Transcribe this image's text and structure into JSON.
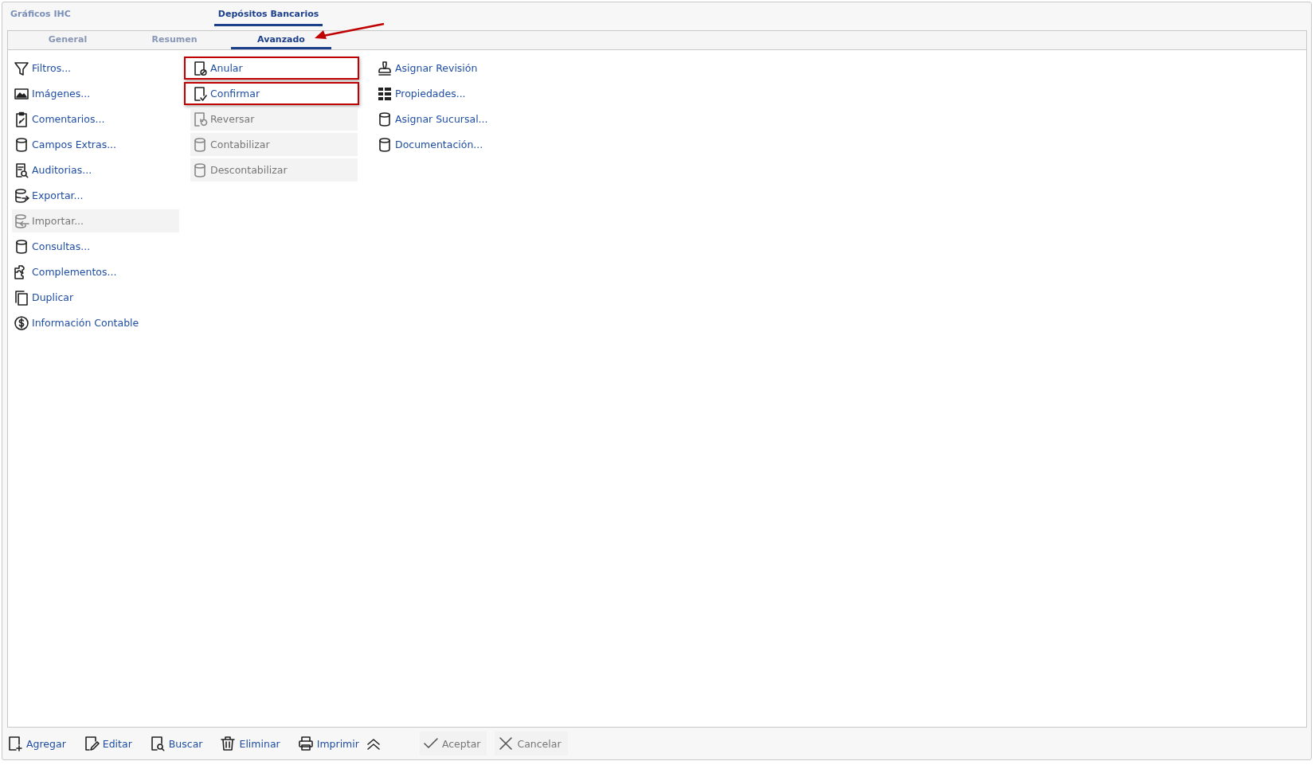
{
  "tabs": [
    {
      "label": "Gráficos IHC",
      "selected": false
    },
    {
      "label": "Depósitos Bancarios",
      "selected": true
    }
  ],
  "subtabs": [
    {
      "label": "General",
      "selected": false
    },
    {
      "label": "Resumen",
      "selected": false
    },
    {
      "label": "Avanzado",
      "selected": true
    }
  ],
  "columns": [
    [
      {
        "label": "Filtros...",
        "kind": "funnel",
        "disabled": false,
        "highlighted": false
      },
      {
        "label": "Imágenes...",
        "kind": "image",
        "disabled": false,
        "highlighted": false
      },
      {
        "label": "Comentarios...",
        "kind": "clipboard",
        "disabled": false,
        "highlighted": false
      },
      {
        "label": "Campos Extras...",
        "kind": "database",
        "disabled": false,
        "highlighted": false
      },
      {
        "label": "Auditorias...",
        "kind": "audit",
        "disabled": false,
        "highlighted": false
      },
      {
        "label": "Exportar...",
        "kind": "export",
        "disabled": false,
        "highlighted": false
      },
      {
        "label": "Importar...",
        "kind": "import",
        "disabled": true,
        "highlighted": false
      },
      {
        "label": "Consultas...",
        "kind": "database",
        "disabled": false,
        "highlighted": false
      },
      {
        "label": "Complementos...",
        "kind": "puzzle",
        "disabled": false,
        "highlighted": false
      },
      {
        "label": "Duplicar",
        "kind": "copy",
        "disabled": false,
        "highlighted": false
      },
      {
        "label": "Información Contable",
        "kind": "dollar",
        "disabled": false,
        "highlighted": false
      }
    ],
    [
      {
        "label": "Anular",
        "kind": "docban",
        "disabled": false,
        "highlighted": true
      },
      {
        "label": "Confirmar",
        "kind": "doccheck",
        "disabled": false,
        "highlighted": true
      },
      {
        "label": "Reversar",
        "kind": "docundo",
        "disabled": true,
        "highlighted": false
      },
      {
        "label": "Contabilizar",
        "kind": "database",
        "disabled": true,
        "highlighted": false
      },
      {
        "label": "Descontabilizar",
        "kind": "database",
        "disabled": true,
        "highlighted": false
      }
    ],
    [
      {
        "label": "Asignar Revisión",
        "kind": "stamp",
        "disabled": false,
        "highlighted": false
      },
      {
        "label": "Propiedades...",
        "kind": "grid",
        "disabled": false,
        "highlighted": false
      },
      {
        "label": "Asignar Sucursal...",
        "kind": "database",
        "disabled": false,
        "highlighted": false
      },
      {
        "label": "Documentación...",
        "kind": "database",
        "disabled": false,
        "highlighted": false
      }
    ]
  ],
  "toolbar": [
    {
      "label": "Agregar",
      "kind": "docplus",
      "disabled": false
    },
    {
      "label": "Editar",
      "kind": "docedit",
      "disabled": false
    },
    {
      "label": "Buscar",
      "kind": "docsearch",
      "disabled": false
    },
    {
      "label": "Eliminar",
      "kind": "trash",
      "disabled": false
    },
    {
      "label": "Imprimir",
      "kind": "printer",
      "disabled": false
    }
  ],
  "actions": [
    {
      "label": "Aceptar",
      "kind": "check",
      "disabled": true
    },
    {
      "label": "Cancelar",
      "kind": "cross",
      "disabled": true
    }
  ]
}
